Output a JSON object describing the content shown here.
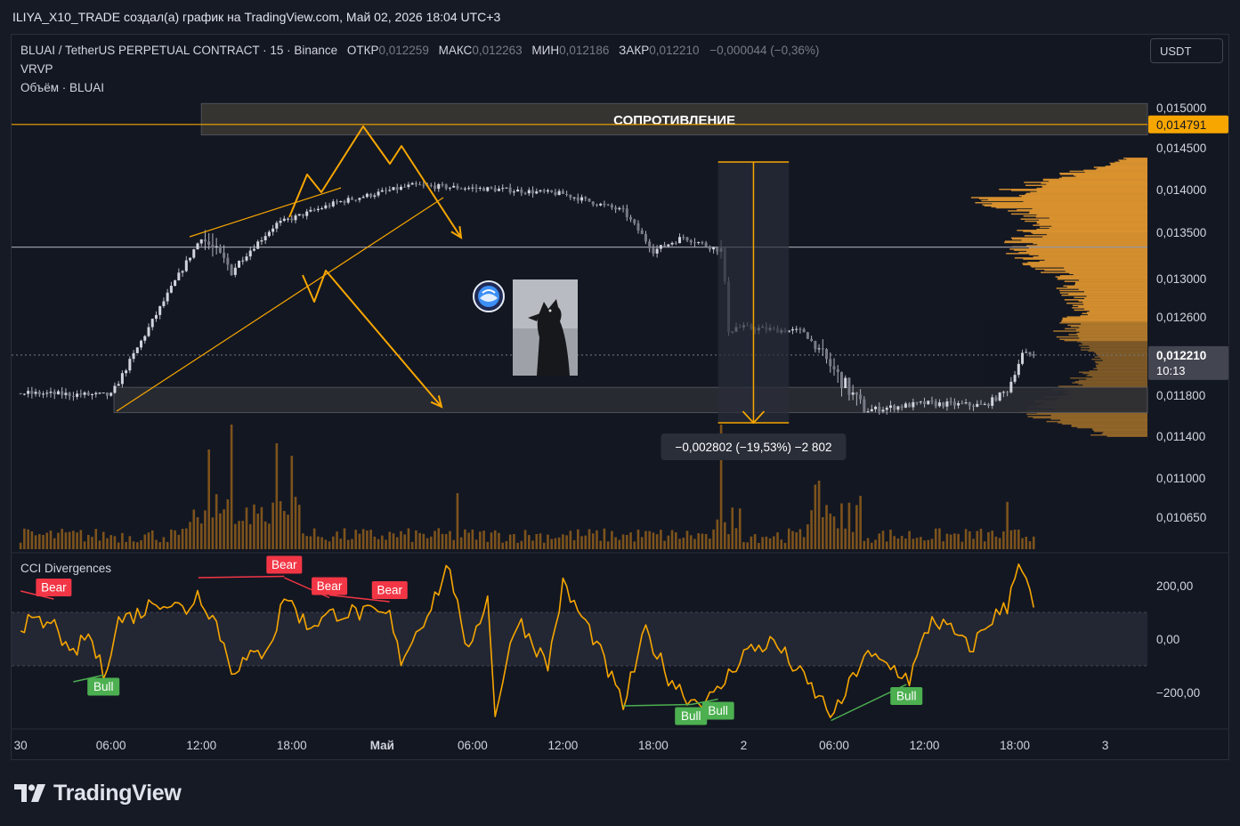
{
  "header": {
    "caption": "ILIYA_X10_TRADE создал(а) график на TradingView.com, Май 02, 2026 18:04 UTC+3"
  },
  "legend": {
    "symbol": "BLUAI / TetherUS PERPETUAL CONTRACT · 15 · Binance",
    "open_label": "ОТКР",
    "open": "0,012259",
    "high_label": "МАКС",
    "high": "0,012263",
    "low_label": "МИН",
    "low": "0,012186",
    "close_label": "ЗАКР",
    "close": "0,012210",
    "change": "−0,000044 (−0,36%)",
    "indicator_vrvp": "VRVP",
    "indicator_volume": "Объём · BLUAI"
  },
  "currency_button": "USDT",
  "cci_title": "CCI Divergences",
  "footer": {
    "brand": "TradingView"
  },
  "colors": {
    "background": "#131722",
    "candle": "#b2b5be",
    "accent_orange": "#f7a600",
    "volume_bar": "#8a5a1c",
    "bear": "#f23645",
    "bull": "#4caf50",
    "cci_line": "#f7a600",
    "vrvp": "#f0a030"
  },
  "chart_data": [
    {
      "type": "candlestick",
      "title": "BLUAI / TetherUS PERPETUAL CONTRACT · 15 · Binance",
      "y_tick_labels": [
        "0,015000",
        "0,014500",
        "0,014000",
        "0,013500",
        "0,013000",
        "0,012600",
        "0,011800",
        "0,011400",
        "0,011000",
        "0,010650"
      ],
      "y_ticks": [
        0.015,
        0.0145,
        0.014,
        0.0135,
        0.013,
        0.0126,
        0.0118,
        0.0114,
        0.011,
        0.01065
      ],
      "x_tick_labels": [
        "30",
        "06:00",
        "12:00",
        "18:00",
        "Май",
        "06:00",
        "12:00",
        "18:00",
        "2",
        "06:00",
        "12:00",
        "18:00",
        "3"
      ],
      "x_ticks_hours": [
        0,
        6,
        12,
        18,
        24,
        30,
        36,
        42,
        48,
        54,
        60,
        66,
        72
      ],
      "x_range_hours": [
        -0.6,
        74.8
      ],
      "price_labels": [
        {
          "value": 0.014791,
          "text": "0,014791",
          "style": "orange"
        },
        {
          "value": 0.01221,
          "text": "0,012210",
          "sub": "10:13",
          "style": "gray"
        }
      ],
      "horizontal_lines": [
        {
          "value": 0.014791,
          "color": "#f7a600"
        },
        {
          "value": 0.01334,
          "color": "#9598a1"
        },
        {
          "value": 0.01221,
          "color": "#787b86",
          "dashed": true
        }
      ],
      "zones": [
        {
          "label": "СОПРОТИВЛЕНИЕ",
          "from_value": 0.01466,
          "to_value": 0.01505,
          "from_hour": 12.0,
          "to_hour": 75
        },
        {
          "label": "",
          "from_value": 0.01163,
          "to_value": 0.01188,
          "from_hour": 6.2,
          "to_hour": 75
        }
      ],
      "measure": {
        "text": "−0,002802 (−19,53%) −2 802",
        "from_hour": 46.3,
        "to_hour": 51.0,
        "top_value": 0.01433,
        "bottom_value": 0.01153
      },
      "key_points": [
        {
          "hour": 0,
          "value": 0.01182
        },
        {
          "hour": 6,
          "value": 0.0118
        },
        {
          "hour": 12,
          "value": 0.01345
        },
        {
          "hour": 14,
          "value": 0.0131
        },
        {
          "hour": 17,
          "value": 0.0136
        },
        {
          "hour": 21,
          "value": 0.01385
        },
        {
          "hour": 26,
          "value": 0.01405
        },
        {
          "hour": 32,
          "value": 0.014
        },
        {
          "hour": 36,
          "value": 0.01395
        },
        {
          "hour": 40,
          "value": 0.01375
        },
        {
          "hour": 42,
          "value": 0.0133
        },
        {
          "hour": 44,
          "value": 0.01345
        },
        {
          "hour": 46.5,
          "value": 0.0133
        },
        {
          "hour": 47,
          "value": 0.0125
        },
        {
          "hour": 52,
          "value": 0.01245
        },
        {
          "hour": 54,
          "value": 0.01205
        },
        {
          "hour": 56,
          "value": 0.01165
        },
        {
          "hour": 60,
          "value": 0.01172
        },
        {
          "hour": 64,
          "value": 0.0117
        },
        {
          "hour": 65.5,
          "value": 0.01185
        },
        {
          "hour": 66.5,
          "value": 0.01222
        },
        {
          "hour": 67.4,
          "value": 0.01221
        }
      ],
      "volume_spikes": [
        {
          "hour": 12.5,
          "value": 0.8
        },
        {
          "hour": 14,
          "value": 1.0
        },
        {
          "hour": 17,
          "value": 0.85
        },
        {
          "hour": 18,
          "value": 0.75
        },
        {
          "hour": 29,
          "value": 0.45
        },
        {
          "hour": 46.5,
          "value": 1.0
        },
        {
          "hour": 53,
          "value": 0.55
        },
        {
          "hour": 65.5,
          "value": 0.38
        }
      ],
      "vrvp_profile": [
        {
          "value": 0.01145,
          "width": 0.3
        },
        {
          "value": 0.0116,
          "width": 0.7
        },
        {
          "value": 0.0118,
          "width": 0.55
        },
        {
          "value": 0.01205,
          "width": 0.35
        },
        {
          "value": 0.0122,
          "width": 0.28
        },
        {
          "value": 0.0124,
          "width": 0.5
        },
        {
          "value": 0.0127,
          "width": 0.42
        },
        {
          "value": 0.013,
          "width": 0.5
        },
        {
          "value": 0.0133,
          "width": 0.78
        },
        {
          "value": 0.0136,
          "width": 0.65
        },
        {
          "value": 0.0139,
          "width": 0.95
        },
        {
          "value": 0.0142,
          "width": 0.45
        },
        {
          "value": 0.01435,
          "width": 0.15
        }
      ]
    },
    {
      "type": "line",
      "title": "CCI Divergences",
      "y_tick_labels": [
        "200,00",
        "0,00",
        "−200,00"
      ],
      "y_ticks": [
        200,
        0,
        -200
      ],
      "y_range": [
        -330,
        310
      ],
      "band": [
        -100,
        100
      ],
      "key_points": [
        {
          "hour": 0,
          "value": 60
        },
        {
          "hour": 2.5,
          "value": 50
        },
        {
          "hour": 3.2,
          "value": -80
        },
        {
          "hour": 4.5,
          "value": 20
        },
        {
          "hour": 5.5,
          "value": -130
        },
        {
          "hour": 6.5,
          "value": 70
        },
        {
          "hour": 8,
          "value": 100
        },
        {
          "hour": 9,
          "value": 150
        },
        {
          "hour": 11,
          "value": 110
        },
        {
          "hour": 11.8,
          "value": 175
        },
        {
          "hour": 13,
          "value": 60
        },
        {
          "hour": 14,
          "value": -110
        },
        {
          "hour": 16,
          "value": -50
        },
        {
          "hour": 17,
          "value": 40
        },
        {
          "hour": 17.5,
          "value": 170
        },
        {
          "hour": 19,
          "value": 50
        },
        {
          "hour": 21,
          "value": 100
        },
        {
          "hour": 22,
          "value": 100
        },
        {
          "hour": 24.5,
          "value": 85
        },
        {
          "hour": 25.2,
          "value": -80
        },
        {
          "hour": 27,
          "value": 100
        },
        {
          "hour": 28.5,
          "value": 280
        },
        {
          "hour": 29.5,
          "value": -50
        },
        {
          "hour": 31,
          "value": 150
        },
        {
          "hour": 31.5,
          "value": -270
        },
        {
          "hour": 33,
          "value": 80
        },
        {
          "hour": 35,
          "value": -100
        },
        {
          "hour": 36,
          "value": 200
        },
        {
          "hour": 38,
          "value": 10
        },
        {
          "hour": 40,
          "value": -250
        },
        {
          "hour": 41.5,
          "value": 30
        },
        {
          "hour": 43,
          "value": -140
        },
        {
          "hour": 44.5,
          "value": -230
        },
        {
          "hour": 46,
          "value": -220
        },
        {
          "hour": 48,
          "value": -50
        },
        {
          "hour": 50,
          "value": -10
        },
        {
          "hour": 52,
          "value": -150
        },
        {
          "hour": 54,
          "value": -290
        },
        {
          "hour": 56,
          "value": -60
        },
        {
          "hour": 58,
          "value": -110
        },
        {
          "hour": 59,
          "value": -150
        },
        {
          "hour": 60.5,
          "value": 80
        },
        {
          "hour": 62,
          "value": 20
        },
        {
          "hour": 63,
          "value": -40
        },
        {
          "hour": 64.5,
          "value": 80
        },
        {
          "hour": 65.5,
          "value": 120
        },
        {
          "hour": 66.2,
          "value": 310
        },
        {
          "hour": 67.4,
          "value": 90
        }
      ],
      "divergences": [
        {
          "label": "Bear",
          "from": {
            "hour": 0,
            "value": 180
          },
          "to": {
            "hour": 2.2,
            "value": 150
          }
        },
        {
          "label": "Bear",
          "from": {
            "hour": 11.8,
            "value": 230
          },
          "to": {
            "hour": 17.5,
            "value": 235
          }
        },
        {
          "label": "Bear",
          "from": {
            "hour": 17.5,
            "value": 230
          },
          "to": {
            "hour": 20.5,
            "value": 155
          }
        },
        {
          "label": "Bear",
          "from": {
            "hour": 20.5,
            "value": 165
          },
          "to": {
            "hour": 24.5,
            "value": 140
          }
        },
        {
          "label": "Bull",
          "from": {
            "hour": 3.5,
            "value": -160
          },
          "to": {
            "hour": 5.5,
            "value": -135
          }
        },
        {
          "label": "Bull",
          "from": {
            "hour": 40,
            "value": -250
          },
          "to": {
            "hour": 44.5,
            "value": -245
          }
        },
        {
          "label": "Bull",
          "from": {
            "hour": 44.5,
            "value": -245
          },
          "to": {
            "hour": 46.3,
            "value": -225
          }
        },
        {
          "label": "Bull",
          "from": {
            "hour": 53.8,
            "value": -305
          },
          "to": {
            "hour": 58.8,
            "value": -170
          }
        }
      ]
    }
  ]
}
